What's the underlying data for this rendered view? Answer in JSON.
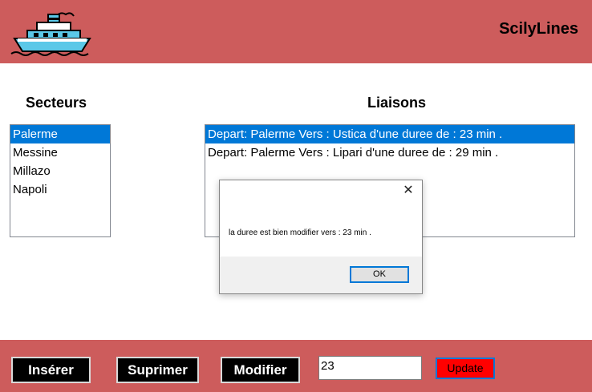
{
  "header": {
    "app_title": "ScilyLines",
    "logo_icon": "ship-icon"
  },
  "sections": {
    "secteurs_title": "Secteurs",
    "liaisons_title": "Liaisons"
  },
  "secteurs": {
    "items": [
      {
        "label": "Palerme",
        "selected": true
      },
      {
        "label": "Messine",
        "selected": false
      },
      {
        "label": "Millazo",
        "selected": false
      },
      {
        "label": "Napoli",
        "selected": false
      }
    ]
  },
  "liaisons": {
    "items": [
      {
        "label": "Depart: Palerme Vers : Ustica d'une duree de : 23 min .",
        "selected": true
      },
      {
        "label": "Depart: Palerme Vers : Lipari d'une duree de : 29 min .",
        "selected": false
      }
    ]
  },
  "dialog": {
    "message": "la duree est bien modifier vers : 23 min .",
    "ok_label": "OK",
    "close_icon": "close-icon"
  },
  "toolbar": {
    "insert_label": "Insérer",
    "delete_label": "Suprimer",
    "modify_label": "Modifier",
    "duration_value": "23",
    "update_label": "Update"
  },
  "colors": {
    "header_bg": "#cd5c5c",
    "selection": "#0078d7",
    "update_button": "#ff0000"
  }
}
